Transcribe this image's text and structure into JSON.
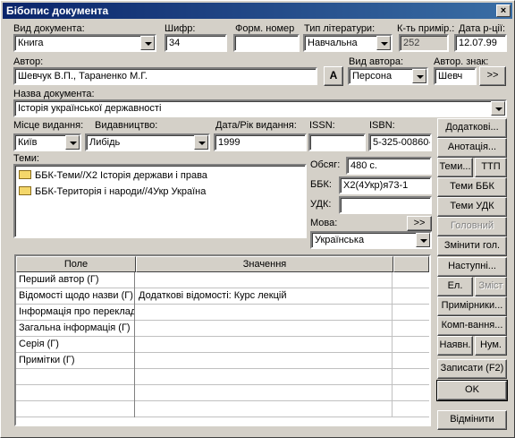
{
  "window": {
    "title": "Бібопис документа",
    "close_glyph": "×"
  },
  "labels": {
    "doc_type": "Вид документа:",
    "cipher": "Шифр:",
    "form_number": "Форм. номер",
    "lit_type": "Тип літератури:",
    "copies": "К-ть приміp.:",
    "date": "Дата р-ції:",
    "author": "Автор:",
    "author_type": "Вид автора:",
    "author_sign": "Автор. знак:",
    "doc_name": "Назва документа:",
    "place": "Місце видання:",
    "publisher": "Видавництво:",
    "year": "Дата/Рік видання:",
    "issn": "ISSN:",
    "isbn": "ISBN:",
    "topics": "Теми:",
    "volume": "Обсяг:",
    "bbk": "ББК:",
    "udk": "УДК:",
    "language": "Мова:"
  },
  "fields": {
    "doc_type": "Книга",
    "cipher": "34",
    "form_number": "",
    "lit_type": "Навчальна",
    "copies": "252",
    "date": "12.07.99",
    "author": "Шевчук В.П., Тараненко М.Г.",
    "author_type": "Персона",
    "author_sign": "Шевч",
    "doc_name": "Історія української державності",
    "place": "Київ",
    "publisher": "Либідь",
    "year": "1999",
    "issn": "",
    "isbn": "5-325-00860-",
    "volume": "480 с.",
    "bbk": "Х2(4Укр)я73-1",
    "udk": "",
    "language": "Українська"
  },
  "topics": [
    "ББК-Теми//Х2 Історія держави і права",
    "ББК-Територія і народи//4Укр Україна"
  ],
  "buttons": {
    "a_button": "A",
    "author_more": ">>",
    "lang_more": ">>",
    "additional": "Додаткові...",
    "annotation": "Анотація...",
    "topics": "Теми...",
    "ttp": "ТТП",
    "bbk_topics": "Теми ББК",
    "udk_topics": "Теми УДК",
    "main": "Головний",
    "change_main": "Змінити гол.",
    "next": "Наступні...",
    "el": "Ел.",
    "contents": "Зміст",
    "copies": "Примірники...",
    "komp": "Комп-вання...",
    "available": "Наявн.",
    "num": "Нум.",
    "save": "Записати (F2)",
    "ok": "OK",
    "cancel": "Відмінити"
  },
  "grid": {
    "headers": [
      "Поле",
      "Значення",
      ""
    ],
    "rows": [
      {
        "field": "Перший автор (Г)",
        "value": ""
      },
      {
        "field": "Відомості щодо назви (Г)",
        "value": "Додаткові відомості: Курс лекцій"
      },
      {
        "field": "Інформація про переклад",
        "value": ""
      },
      {
        "field": "Загальна інформація (Г)",
        "value": ""
      },
      {
        "field": "Серія (Г)",
        "value": ""
      },
      {
        "field": "Примітки (Г)",
        "value": ""
      }
    ]
  }
}
